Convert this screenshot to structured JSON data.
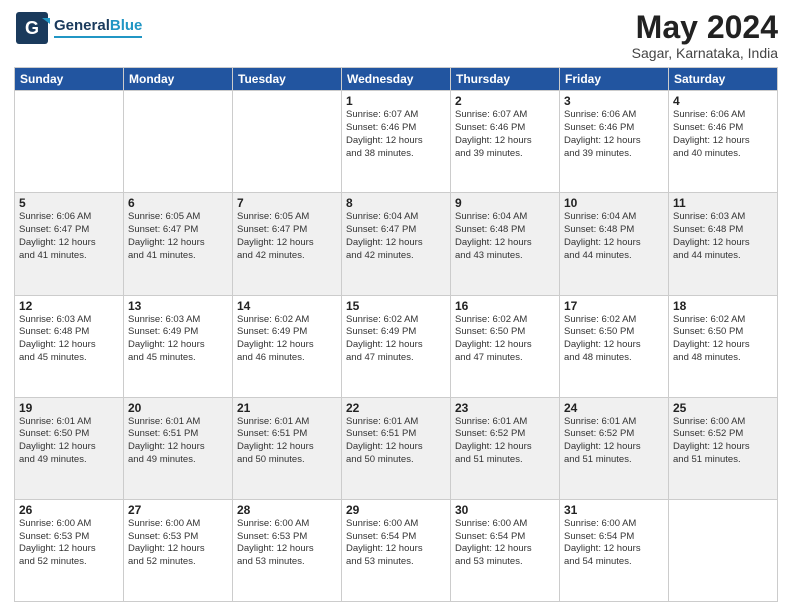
{
  "header": {
    "logo_general": "General",
    "logo_blue": "Blue",
    "month_year": "May 2024",
    "location": "Sagar, Karnataka, India"
  },
  "weekdays": [
    "Sunday",
    "Monday",
    "Tuesday",
    "Wednesday",
    "Thursday",
    "Friday",
    "Saturday"
  ],
  "weeks": [
    [
      {
        "day": "",
        "info": ""
      },
      {
        "day": "",
        "info": ""
      },
      {
        "day": "",
        "info": ""
      },
      {
        "day": "1",
        "info": "Sunrise: 6:07 AM\nSunset: 6:46 PM\nDaylight: 12 hours\nand 38 minutes."
      },
      {
        "day": "2",
        "info": "Sunrise: 6:07 AM\nSunset: 6:46 PM\nDaylight: 12 hours\nand 39 minutes."
      },
      {
        "day": "3",
        "info": "Sunrise: 6:06 AM\nSunset: 6:46 PM\nDaylight: 12 hours\nand 39 minutes."
      },
      {
        "day": "4",
        "info": "Sunrise: 6:06 AM\nSunset: 6:46 PM\nDaylight: 12 hours\nand 40 minutes."
      }
    ],
    [
      {
        "day": "5",
        "info": "Sunrise: 6:06 AM\nSunset: 6:47 PM\nDaylight: 12 hours\nand 41 minutes."
      },
      {
        "day": "6",
        "info": "Sunrise: 6:05 AM\nSunset: 6:47 PM\nDaylight: 12 hours\nand 41 minutes."
      },
      {
        "day": "7",
        "info": "Sunrise: 6:05 AM\nSunset: 6:47 PM\nDaylight: 12 hours\nand 42 minutes."
      },
      {
        "day": "8",
        "info": "Sunrise: 6:04 AM\nSunset: 6:47 PM\nDaylight: 12 hours\nand 42 minutes."
      },
      {
        "day": "9",
        "info": "Sunrise: 6:04 AM\nSunset: 6:48 PM\nDaylight: 12 hours\nand 43 minutes."
      },
      {
        "day": "10",
        "info": "Sunrise: 6:04 AM\nSunset: 6:48 PM\nDaylight: 12 hours\nand 44 minutes."
      },
      {
        "day": "11",
        "info": "Sunrise: 6:03 AM\nSunset: 6:48 PM\nDaylight: 12 hours\nand 44 minutes."
      }
    ],
    [
      {
        "day": "12",
        "info": "Sunrise: 6:03 AM\nSunset: 6:48 PM\nDaylight: 12 hours\nand 45 minutes."
      },
      {
        "day": "13",
        "info": "Sunrise: 6:03 AM\nSunset: 6:49 PM\nDaylight: 12 hours\nand 45 minutes."
      },
      {
        "day": "14",
        "info": "Sunrise: 6:02 AM\nSunset: 6:49 PM\nDaylight: 12 hours\nand 46 minutes."
      },
      {
        "day": "15",
        "info": "Sunrise: 6:02 AM\nSunset: 6:49 PM\nDaylight: 12 hours\nand 47 minutes."
      },
      {
        "day": "16",
        "info": "Sunrise: 6:02 AM\nSunset: 6:50 PM\nDaylight: 12 hours\nand 47 minutes."
      },
      {
        "day": "17",
        "info": "Sunrise: 6:02 AM\nSunset: 6:50 PM\nDaylight: 12 hours\nand 48 minutes."
      },
      {
        "day": "18",
        "info": "Sunrise: 6:02 AM\nSunset: 6:50 PM\nDaylight: 12 hours\nand 48 minutes."
      }
    ],
    [
      {
        "day": "19",
        "info": "Sunrise: 6:01 AM\nSunset: 6:50 PM\nDaylight: 12 hours\nand 49 minutes."
      },
      {
        "day": "20",
        "info": "Sunrise: 6:01 AM\nSunset: 6:51 PM\nDaylight: 12 hours\nand 49 minutes."
      },
      {
        "day": "21",
        "info": "Sunrise: 6:01 AM\nSunset: 6:51 PM\nDaylight: 12 hours\nand 50 minutes."
      },
      {
        "day": "22",
        "info": "Sunrise: 6:01 AM\nSunset: 6:51 PM\nDaylight: 12 hours\nand 50 minutes."
      },
      {
        "day": "23",
        "info": "Sunrise: 6:01 AM\nSunset: 6:52 PM\nDaylight: 12 hours\nand 51 minutes."
      },
      {
        "day": "24",
        "info": "Sunrise: 6:01 AM\nSunset: 6:52 PM\nDaylight: 12 hours\nand 51 minutes."
      },
      {
        "day": "25",
        "info": "Sunrise: 6:00 AM\nSunset: 6:52 PM\nDaylight: 12 hours\nand 51 minutes."
      }
    ],
    [
      {
        "day": "26",
        "info": "Sunrise: 6:00 AM\nSunset: 6:53 PM\nDaylight: 12 hours\nand 52 minutes."
      },
      {
        "day": "27",
        "info": "Sunrise: 6:00 AM\nSunset: 6:53 PM\nDaylight: 12 hours\nand 52 minutes."
      },
      {
        "day": "28",
        "info": "Sunrise: 6:00 AM\nSunset: 6:53 PM\nDaylight: 12 hours\nand 53 minutes."
      },
      {
        "day": "29",
        "info": "Sunrise: 6:00 AM\nSunset: 6:54 PM\nDaylight: 12 hours\nand 53 minutes."
      },
      {
        "day": "30",
        "info": "Sunrise: 6:00 AM\nSunset: 6:54 PM\nDaylight: 12 hours\nand 53 minutes."
      },
      {
        "day": "31",
        "info": "Sunrise: 6:00 AM\nSunset: 6:54 PM\nDaylight: 12 hours\nand 54 minutes."
      },
      {
        "day": "",
        "info": ""
      }
    ]
  ]
}
